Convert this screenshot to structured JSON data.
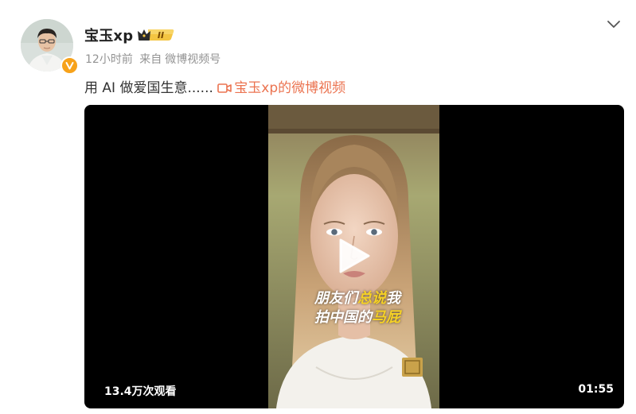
{
  "post": {
    "author": "宝玉xp",
    "level_badge": "II",
    "time": "12小时前",
    "source_prefix": "来自",
    "source": "微博视频号",
    "text": "用 AI 做爱国生意......",
    "video_link_label": "宝玉xp的微博视频"
  },
  "video": {
    "views": "13.4万次观看",
    "duration": "01:55",
    "caption_line1_a": "朋友们",
    "caption_line1_hl": "总说",
    "caption_line1_b": "我",
    "caption_line2_a": "拍中国的",
    "caption_line2_hl": "马屁"
  },
  "colors": {
    "link": "#eb7350",
    "verify_badge": "#f7a21a",
    "caption_highlight": "#f5d125"
  },
  "icons": {
    "verify": "verified-v-icon",
    "badge": "crown-level-badge-icon",
    "menu": "chevron-down-icon",
    "video_link": "video-camera-icon",
    "play": "play-icon"
  }
}
